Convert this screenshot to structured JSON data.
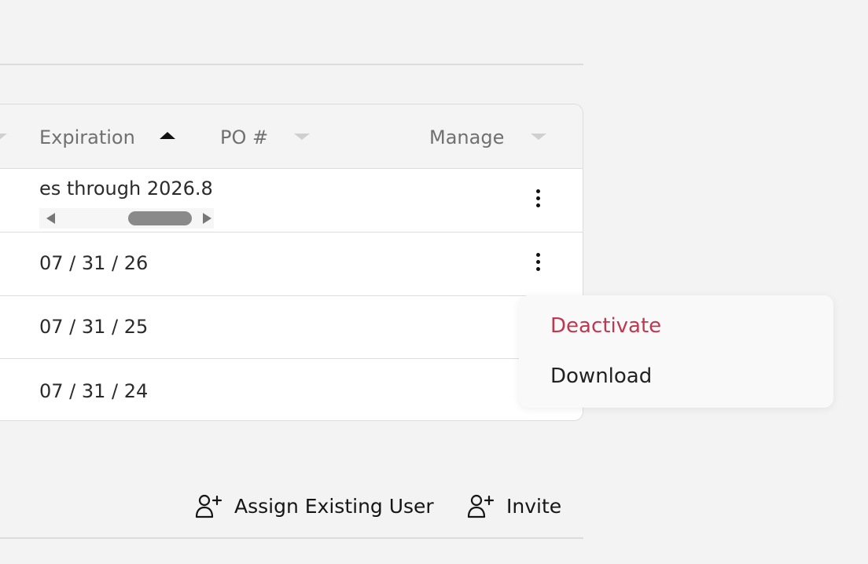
{
  "table": {
    "columns": [
      {
        "label": "Expiration",
        "sort": "ascending"
      },
      {
        "label": "PO #",
        "sort": "none"
      },
      {
        "label": "Manage",
        "sort": "none"
      }
    ],
    "rows": [
      {
        "expiration": "es through 2026.8",
        "has_menu": true,
        "scroll_fraction": 0.55
      },
      {
        "expiration": "07 / 31 / 26",
        "has_menu": true
      },
      {
        "expiration": "07 / 31 / 25",
        "has_menu": false
      },
      {
        "expiration": "07 / 31 / 24",
        "has_menu": false
      }
    ]
  },
  "context_menu": {
    "items": [
      {
        "label": "Deactivate",
        "color": "#c0384f"
      },
      {
        "label": "Download",
        "color": "#222222"
      }
    ]
  },
  "actions": {
    "assign_label": "Assign Existing User",
    "invite_label": "Invite",
    "icon": "user-plus-icon"
  },
  "colors": {
    "background": "#f3f3f3",
    "danger": "#c0384f",
    "header_text": "#707070"
  }
}
